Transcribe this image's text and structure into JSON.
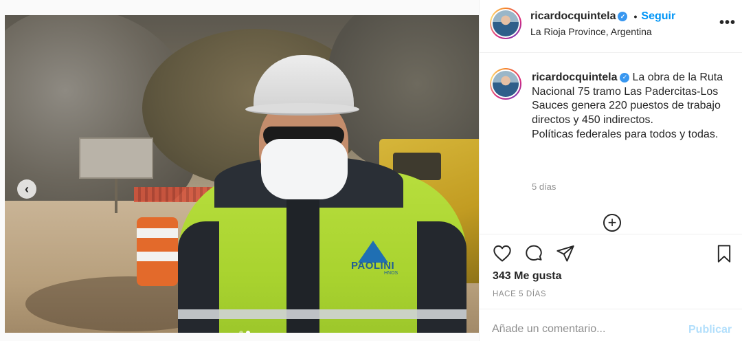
{
  "post": {
    "username": "ricardocquintela",
    "follow_label": "Seguir",
    "location": "La Rioja Province, Argentina",
    "more_label": "•••",
    "verified_mark": "✓",
    "bullet": "•"
  },
  "caption": {
    "username": "ricardocquintela",
    "line1": "La obra de la Ruta Nacional 75 tramo Las Padercitas-Los Sauces genera 220 puestos de trabajo directos y 450 indirectos.",
    "line2": "Políticas federales para todos y todas.",
    "time": "5 días"
  },
  "media": {
    "prev_glyph": "‹",
    "jacket_logo": "PAOLINI",
    "jacket_logo_sub": "HNOS",
    "carousel_dots": 2,
    "active_dot": 2
  },
  "load_more_glyph": "+",
  "actions": {
    "likes": "343 Me gusta",
    "posted": "HACE 5 DÍAS"
  },
  "comment": {
    "placeholder": "Añade un comentario...",
    "publish_label": "Publicar"
  },
  "colors": {
    "follow": "#0095f6",
    "publish_disabled": "#b2dffc",
    "verified": "#3897f0"
  },
  "icons": [
    "chevron-left-icon",
    "more-icon",
    "verified-icon",
    "plus-circle-icon",
    "heart-icon",
    "comment-icon",
    "share-icon",
    "bookmark-icon"
  ]
}
